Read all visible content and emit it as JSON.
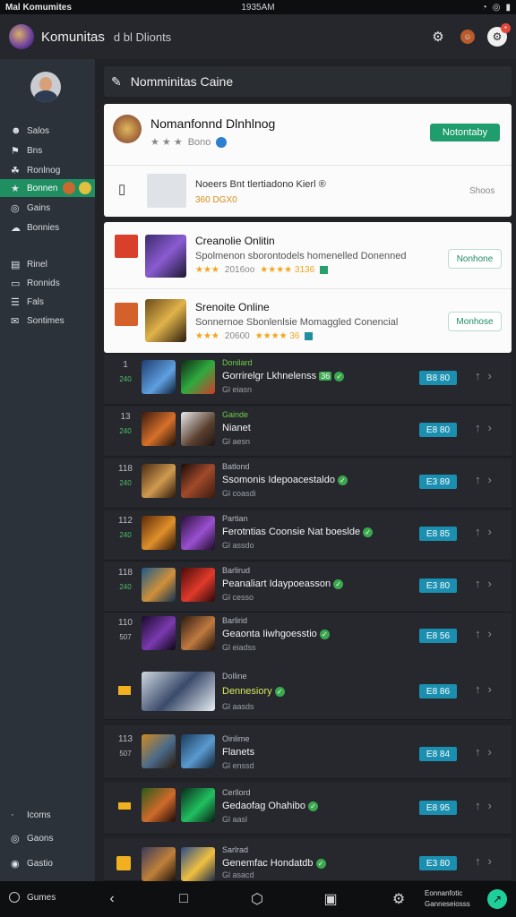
{
  "status_bar": {
    "left": "Mal Komumites",
    "time": "1935AM",
    "icons": [
      "wifi-icon",
      "signal-icon",
      "battery-icon"
    ]
  },
  "header": {
    "title": "Komunitas",
    "subtitle": "d bl Dlionts"
  },
  "sidebar": {
    "items": [
      {
        "label": "Salos",
        "icon": "users-icon"
      },
      {
        "label": "Bns",
        "icon": "flag-icon"
      },
      {
        "label": "Ronlnog",
        "icon": "trophy-icon"
      },
      {
        "label": "Bonnen",
        "icon": "star-icon",
        "active": true
      },
      {
        "label": "Gains",
        "icon": "search-icon"
      },
      {
        "label": "Bonnies",
        "icon": "cloud-icon"
      }
    ],
    "items2": [
      {
        "label": "Rinel",
        "icon": "calendar-icon"
      },
      {
        "label": "Ronnids",
        "icon": "card-icon"
      },
      {
        "label": "Fals",
        "icon": "list-icon"
      },
      {
        "label": "Sontimes",
        "icon": "mail-icon"
      }
    ],
    "bottom": [
      {
        "label": "Icoms",
        "icon": "dot-icon"
      },
      {
        "label": "Gaons",
        "icon": "shield-icon"
      },
      {
        "label": "Gastio",
        "icon": "settings-icon"
      }
    ]
  },
  "section": {
    "title": "Nomminitas Caine"
  },
  "feature": {
    "title": "Nomanfonnd Dlnhlnog",
    "meta": "Bono",
    "button": "Notontaby",
    "item_title": "Noeers Bnt tlertiadono Kierl ®",
    "item_sub": "360 DGX0",
    "item_right": "Shoos"
  },
  "cards": [
    {
      "title": "Creanolie Onlitin",
      "desc": "Spolmenon sborontodels homenelled Donenned",
      "stars": "★★★",
      "meta": "2016oo",
      "rating": "★★★★ 3136",
      "button": "Nonhone"
    },
    {
      "title": "Srenoite Online",
      "desc": "Sonnernoe Sbonlenlsie Momaggled Conencial",
      "stars": "★★★",
      "meta": "20600",
      "rating": "★★★★ 36",
      "button": "Monhose"
    }
  ],
  "rows": [
    {
      "rank": "1",
      "sub": "240",
      "tag": "Donilard",
      "name": "Gorrirelgr Lkhnelenss",
      "name_extra": "36",
      "sub2": "Gl eiasn",
      "pill": "B8 80"
    },
    {
      "rank": "13",
      "sub": "240",
      "tag": "Gainde",
      "name": "Nianet",
      "name_extra": "",
      "sub2": "Gl aesn",
      "pill": "E8 80"
    },
    {
      "rank": "118",
      "sub": "240",
      "tag": "Batlond",
      "name": "Ssomonis Idepoacestaldo",
      "name_extra": "",
      "sub2": "Gl coasdi",
      "pill": "E3 89"
    },
    {
      "rank": "112",
      "sub": "240",
      "tag": "Partian",
      "name": "Ferotntias Coonsie Nat boeslde",
      "name_extra": "",
      "sub2": "Gl assdo",
      "pill": "E8 85"
    },
    {
      "rank": "118",
      "sub": "240",
      "tag": "Barlirud",
      "name": "Peanaliart Idaypoeasson",
      "name_extra": "",
      "sub2": "Gl cesso",
      "pill": "E3 80"
    },
    {
      "rank": "110",
      "sub": "507",
      "tag": "Barlirid",
      "name": "Geaonta Iiwhgoesstio",
      "name_extra": "",
      "sub2": "Gl eiadss",
      "pill": "E8 56"
    },
    {
      "rank": "",
      "sub": "",
      "tag": "Dolline",
      "name": "Dennesiory",
      "name_extra": "",
      "sub2": "Gl aasds",
      "pill": "E8 86"
    },
    {
      "rank": "113",
      "sub": "507",
      "tag": "Oinlime",
      "name": "Flanets",
      "name_extra": "",
      "sub2": "Gl enssd",
      "pill": "E8 84"
    },
    {
      "rank": "",
      "sub": "",
      "tag": "Cerllord",
      "name": "Gedaofag Ohahibo",
      "name_extra": "",
      "sub2": "Gl aasl",
      "pill": "E8 95"
    },
    {
      "rank": "",
      "sub": "",
      "tag": "Sarlrad",
      "name": "Genemfac Hondatdb",
      "name_extra": "",
      "sub2": "Gl asacd",
      "pill": "E3 80"
    }
  ],
  "nav": {
    "left": "Gumes",
    "right1": "Eonnanfotic",
    "right2": "Ganneseiosss"
  },
  "colors": {
    "accent": "#1f9d6c",
    "pill": "#1b8fb0",
    "sidebar": "#2c3239",
    "background": "#202226"
  }
}
